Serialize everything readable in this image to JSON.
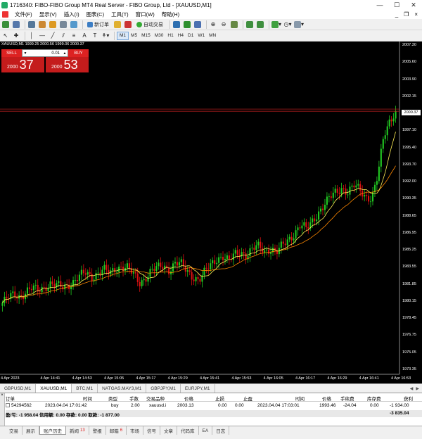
{
  "window": {
    "title": "1716340: FIBO-FIBO Group MT4 Real Server - FIBO Group, Ltd - [XAUUSD,M1]",
    "minimize": "—",
    "maximize": "☐",
    "close": "✕"
  },
  "menu": {
    "items": [
      "文件(F)",
      "显示(V)",
      "插入(I)",
      "图表(C)",
      "工具(T)",
      "窗口(W)",
      "帮助(H)"
    ],
    "mdi_controls": [
      "_",
      "❐",
      "×"
    ]
  },
  "toolbar1": {
    "new_order": "新订单",
    "auto_trading": "自动交易"
  },
  "toolbar2": {
    "timeframes": [
      "M1",
      "M5",
      "M15",
      "M30",
      "H1",
      "H4",
      "D1",
      "W1",
      "MN"
    ],
    "active_timeframe": "M1"
  },
  "chart": {
    "symbol_label": "XAUUSD,M1  1999.25 2000.56 1999.06 2000.37",
    "current_price": "2000.37",
    "price_ticks": [
      "2007.30",
      "2005.60",
      "2003.90",
      "2002.15",
      "2000.45",
      "1997.10",
      "1995.40",
      "1993.70",
      "1992.00",
      "1990.35",
      "1988.65",
      "1986.95",
      "1985.25",
      "1983.55",
      "1981.85",
      "1980.15",
      "1978.45",
      "1976.75",
      "1975.05",
      "1973.35"
    ],
    "time_ticks": [
      "4 Apr 2023",
      "4 Apr 14:41",
      "4 Apr 14:53",
      "4 Apr 15:05",
      "4 Apr 15:17",
      "4 Apr 15:29",
      "4 Apr 15:41",
      "4 Apr 15:53",
      "4 Apr 16:05",
      "4 Apr 16:17",
      "4 Apr 16:29",
      "4 Apr 16:41",
      "4 Apr 16:53"
    ],
    "colors": {
      "bull": "#22cc22",
      "bear": "#dd1111",
      "ma_fast": "#ffee55",
      "ma_slow": "#ff8800",
      "price_line": "#cc2222"
    }
  },
  "chart_data": {
    "type": "candlestick",
    "symbol": "XAUUSD,M1",
    "ylim": [
      1973.35,
      2007.3
    ],
    "close_series_approx": [
      1980.3,
      1980.8,
      1981.2,
      1981.0,
      1981.5,
      1981.8,
      1981.6,
      1982.0,
      1982.3,
      1982.1,
      1981.9,
      1982.2,
      1982.6,
      1983.1,
      1983.4,
      1983.0,
      1983.5,
      1983.8,
      1983.3,
      1983.9,
      1984.2,
      1984.0,
      1983.2,
      1982.4,
      1983.0,
      1983.7,
      1983.9,
      1984.2,
      1983.8,
      1984.5,
      1984.3,
      1983.6,
      1983.1,
      1982.7,
      1983.5,
      1984.3,
      1985.0,
      1985.2,
      1984.6,
      1985.4,
      1985.7,
      1985.3,
      1985.9,
      1986.2,
      1985.8,
      1986.0,
      1985.5,
      1986.3,
      1987.0,
      1987.6,
      1988.4,
      1988.0,
      1988.9,
      1989.8,
      1990.5,
      1991.3,
      1992.0,
      1992.4,
      1991.8,
      1992.5,
      1992.2,
      1991.5,
      1991.2,
      1993.5,
      1997.8,
      1999.5,
      2000.37
    ]
  },
  "trade_panel": {
    "sell_label": "SELL",
    "buy_label": "BUY",
    "lot": "0.01",
    "sell_price_small": "2000",
    "sell_price_big": "37",
    "buy_price_small": "2000",
    "buy_price_big": "53"
  },
  "chart_tabs": {
    "items": [
      "GBPUSD,M1",
      "XAUUSD,M1",
      "BTC,M1",
      "NATGAS.MAY3,M1",
      "GBPJPY,M1",
      "EURJPY,M1"
    ],
    "active": "XAUUSD,M1"
  },
  "terminal": {
    "headers": [
      "订单",
      "时间",
      "类型",
      "手数",
      "交易品种",
      "价格",
      "止损",
      "止盈",
      "时间",
      "价格",
      "手续费",
      "库存费",
      "获利"
    ],
    "row": [
      "54294562",
      "2023.04.04 17:01:42",
      "buy",
      "2.00",
      "xauusd.i",
      "2003.13",
      "0.00",
      "0.00",
      "2023.04.04 17:03:01",
      "1993.46",
      "-24.04",
      "0.00",
      "-1 934.00"
    ],
    "summary": {
      "text": "盈/亏: -1 958.04  信用额: 0.00  存款: 0.00  取款: -1 877.00",
      "total": "-3 835.04"
    },
    "side_label": "终端"
  },
  "terminal_tabs": {
    "items": [
      "交易",
      "展示",
      "账户历史",
      "新闻",
      "警报",
      "邮箱",
      "市场",
      "信号",
      "文章",
      "代码库",
      "EA",
      "日志"
    ],
    "active": "账户历史",
    "news_badge": "13",
    "mail_badge": "6"
  }
}
